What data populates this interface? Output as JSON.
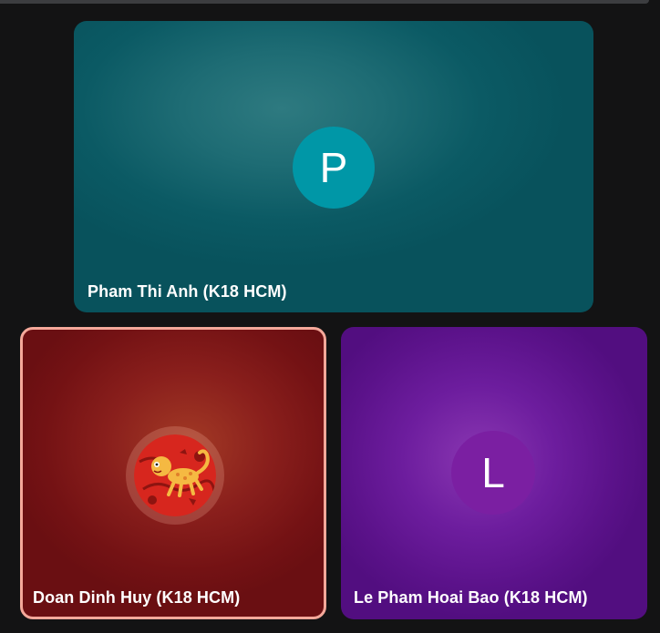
{
  "meeting": {
    "participants": [
      {
        "name": "Pham Thi Anh (K18 HCM)",
        "initial": "P",
        "avatar_color": "#0097a7",
        "tile_color": "#0b5a64",
        "avatar_type": "initial"
      },
      {
        "name": "Doan Dinh Huy (K18 HCM)",
        "initial": "",
        "avatar_color": "#d7261e",
        "tile_color": "#741214",
        "avatar_type": "photo",
        "avatar_icon": "golden-monkey-icon",
        "active_speaker": true,
        "highlight_color": "#f4a89a"
      },
      {
        "name": "Le Pham Hoai Bao (K18 HCM)",
        "initial": "L",
        "avatar_color": "#7b1fa2",
        "tile_color": "#5b128a",
        "avatar_type": "initial"
      }
    ]
  }
}
